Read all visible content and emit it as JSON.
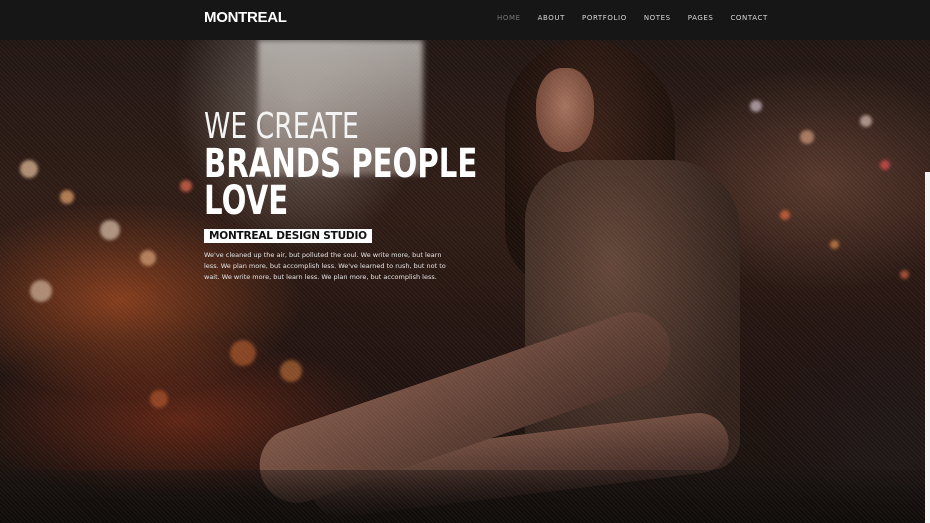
{
  "header": {
    "logo": "MONTREAL",
    "nav": [
      {
        "label": "HOME",
        "active": true
      },
      {
        "label": "ABOUT",
        "active": false
      },
      {
        "label": "PORTFOLIO",
        "active": false
      },
      {
        "label": "NOTES",
        "active": false
      },
      {
        "label": "PAGES",
        "active": false
      },
      {
        "label": "CONTACT",
        "active": false
      }
    ]
  },
  "hero": {
    "headline_light": "WE CREATE",
    "headline_bold_1": "BRANDS PEOPLE",
    "headline_bold_2": "LOVE",
    "studio_label": "MONTREAL DESIGN STUDIO",
    "tagline": "We've cleaned up the air, but polluted the soul. We write more, but learn less. We plan more, but accomplish less. We've learned to rush, but not to wait. We write more, but learn less. We plan more, but accomplish less."
  },
  "colors": {
    "navbar_bg": "#161616",
    "nav_active": "#7a7a7a",
    "nav_text": "#d8d8d8",
    "label_bg": "#ffffff"
  }
}
